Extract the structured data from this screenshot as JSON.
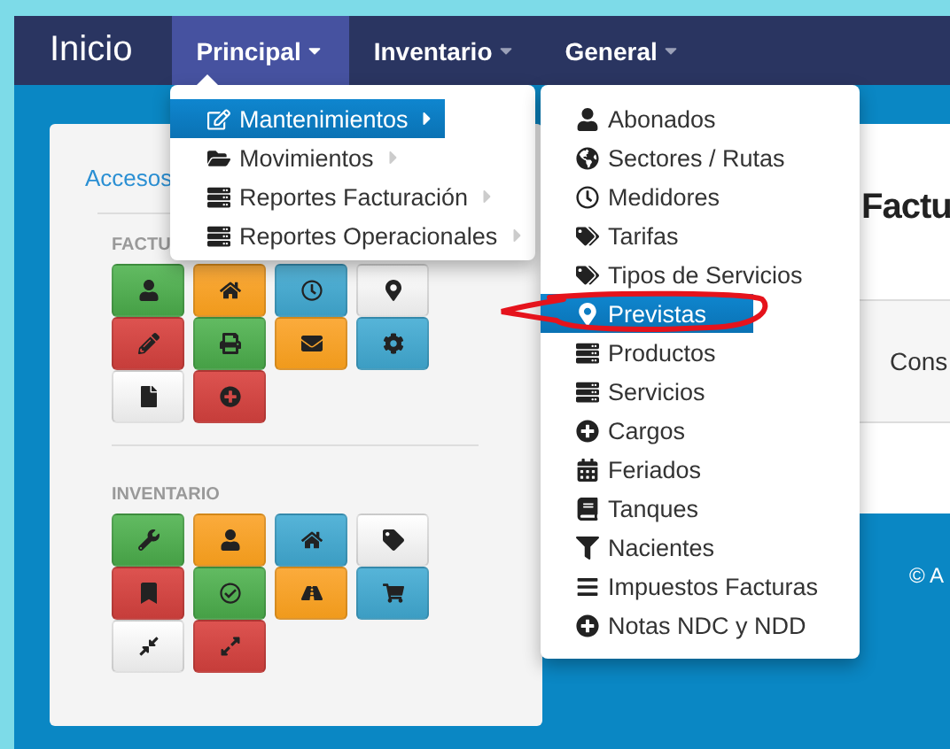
{
  "navbar": {
    "brand": "Inicio",
    "menus": [
      {
        "label": "Principal",
        "selected": true
      },
      {
        "label": "Inventario",
        "selected": false
      },
      {
        "label": "General",
        "selected": false
      }
    ]
  },
  "principal_menu": [
    {
      "label": "Mantenimientos",
      "selected": true
    },
    {
      "label": "Movimientos",
      "selected": false
    },
    {
      "label": "Reportes Facturación",
      "selected": false
    },
    {
      "label": "Reportes Operacionales",
      "selected": false
    }
  ],
  "mantenimientos_menu": [
    {
      "label": "Abonados",
      "selected": false
    },
    {
      "label": "Sectores / Rutas",
      "selected": false
    },
    {
      "label": "Medidores",
      "selected": false
    },
    {
      "label": "Tarifas",
      "selected": false
    },
    {
      "label": "Tipos de Servicios",
      "selected": false
    },
    {
      "label": "Previstas",
      "selected": true
    },
    {
      "label": "Productos",
      "selected": false
    },
    {
      "label": "Servicios",
      "selected": false
    },
    {
      "label": "Cargos",
      "selected": false
    },
    {
      "label": "Feriados",
      "selected": false
    },
    {
      "label": "Tanques",
      "selected": false
    },
    {
      "label": "Nacientes",
      "selected": false
    },
    {
      "label": "Impuestos Facturas",
      "selected": false
    },
    {
      "label": "Notas NDC y NDD",
      "selected": false
    }
  ],
  "shortcuts_panel": {
    "link": "Accesos",
    "sections": [
      {
        "title": "FACTU",
        "tiles": [
          {
            "kind": "success"
          },
          {
            "kind": "warning"
          },
          {
            "kind": "info"
          },
          {
            "kind": "default"
          },
          {
            "kind": "danger"
          },
          {
            "kind": "success"
          },
          {
            "kind": "warning"
          },
          {
            "kind": "info"
          },
          {
            "kind": "default"
          },
          {
            "kind": "danger"
          }
        ]
      },
      {
        "title": "INVENTARIO",
        "tiles": [
          {
            "kind": "success"
          },
          {
            "kind": "warning"
          },
          {
            "kind": "info"
          },
          {
            "kind": "default"
          },
          {
            "kind": "danger"
          },
          {
            "kind": "success"
          },
          {
            "kind": "warning"
          },
          {
            "kind": "info"
          },
          {
            "kind": "default"
          },
          {
            "kind": "danger"
          }
        ]
      }
    ]
  },
  "content": {
    "heading": "Factu",
    "label": "Cons"
  },
  "footer": {
    "text": "© A"
  }
}
